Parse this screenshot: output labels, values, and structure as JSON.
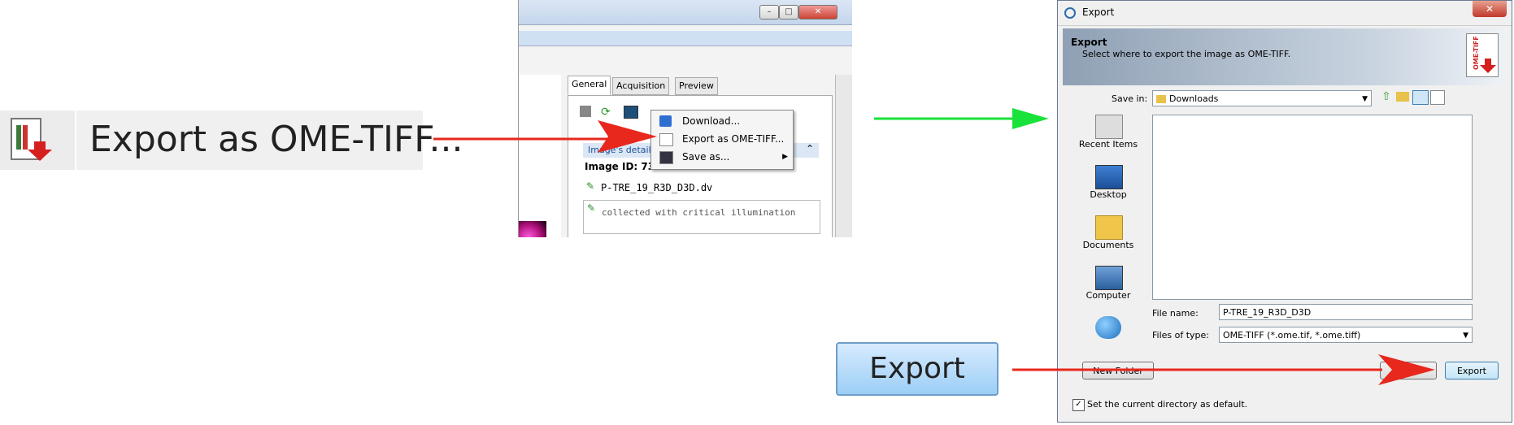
{
  "zoom_menu_item": {
    "label": "Export as OME-TIFF..."
  },
  "middle_screenshot": {
    "tabs": [
      "General",
      "Acquisition",
      "Preview"
    ],
    "context_menu": [
      "Download...",
      "Export as OME-TIFF...",
      "Save as..."
    ],
    "details_header": "Image's details",
    "image_id": "Image ID: 7396",
    "file_name": "P-TRE_19_R3D_D3D.dv",
    "description": "collected with critical illumination"
  },
  "zoom_button": {
    "label": "Export"
  },
  "dialog": {
    "title": "Export",
    "banner_title": "Export",
    "banner_subtitle": "Select where to export the image as OME-TIFF.",
    "doc_icon_text": "OME-TIFF",
    "save_in_label": "Save in:",
    "save_in_value": "Downloads",
    "places": [
      "Recent Items",
      "Desktop",
      "Documents",
      "Computer"
    ],
    "file_name_label": "File name:",
    "file_name_value": "P-TRE_19_R3D_D3D",
    "files_of_type_label": "Files of type:",
    "files_of_type_value": "OME-TIFF (*.ome.tif, *.ome.tiff)",
    "new_folder_button": "New Folder",
    "export_button": "Export",
    "checkbox_label": "Set the current directory as default.",
    "checkbox_checked": true
  },
  "colors": {
    "red_arrow": "#e8271d",
    "green_arrow": "#19e23a"
  }
}
